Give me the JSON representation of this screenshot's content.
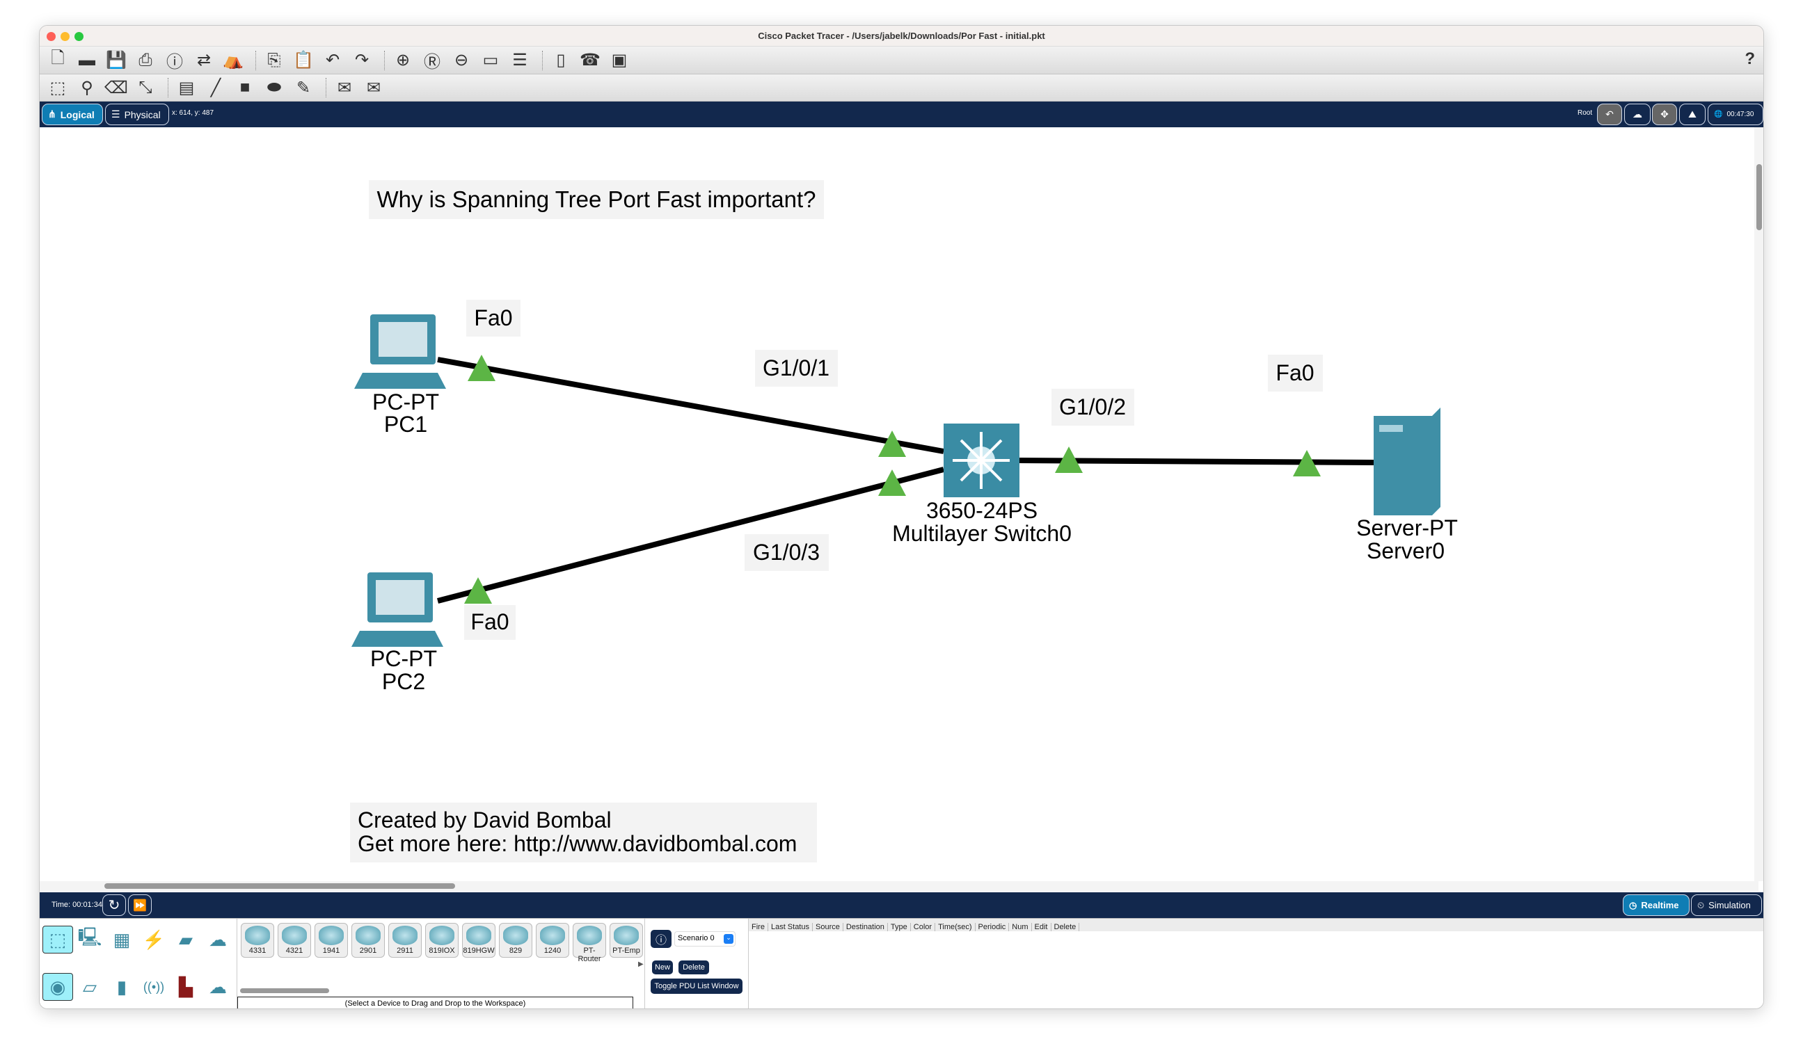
{
  "window": {
    "title": "Cisco Packet Tracer - /Users/jabelk/Downloads/Por Fast - initial.pkt"
  },
  "toolbar1": {
    "icons": [
      "new-file-icon",
      "open-folder-icon",
      "save-icon",
      "print-icon",
      "info-icon",
      "activity-wizard-icon",
      "custom-device-icon",
      "|",
      "copy-icon",
      "paste-icon",
      "undo-icon",
      "redo-icon",
      "|",
      "zoom-in-icon",
      "zoom-reset-icon",
      "zoom-out-icon",
      "window-icon",
      "list-icon",
      "|",
      "device-template-icon",
      "ip-phone-icon",
      "image-icon"
    ],
    "help": "?"
  },
  "toolbar2": {
    "icons": [
      "select-icon",
      "inspect-icon",
      "delete-icon",
      "resize-icon",
      "|",
      "note-icon",
      "line-icon",
      "rectangle-icon",
      "ellipse-icon",
      "freeform-icon",
      "|",
      "simple-pdu-icon",
      "complex-pdu-icon"
    ]
  },
  "nav": {
    "logical": "Logical",
    "physical": "Physical",
    "coords": "x: 614, y: 487",
    "root": "Root",
    "clock": "00:47:30"
  },
  "canvas": {
    "heading": "Why is Spanning Tree Port Fast important?",
    "credits": [
      "Created by David Bombal",
      "Get more here: http://www.davidbombal.com"
    ],
    "devices": [
      {
        "model": "PC-PT",
        "name": "PC1"
      },
      {
        "model": "PC-PT",
        "name": "PC2"
      },
      {
        "model": "3650-24PS",
        "name": "Multilayer Switch0"
      },
      {
        "model": "Server-PT",
        "name": "Server0"
      }
    ],
    "ports": {
      "pc1": "Fa0",
      "sw_pc1": "G1/0/1",
      "pc2": "Fa0",
      "sw_pc2": "G1/0/3",
      "sw_srv": "G1/0/2",
      "srv": "Fa0"
    },
    "link_color": "#000000",
    "link_status_color": "#5cb545"
  },
  "bottom": {
    "time": "Time: 00:01:34",
    "realtime": "Realtime",
    "simulation": "Simulation"
  },
  "panel": {
    "devices": [
      "4331",
      "4321",
      "1941",
      "2901",
      "2911",
      "819IOX",
      "819HGW",
      "829",
      "1240",
      "PT-Router",
      "PT-Emp"
    ],
    "hint": "(Select a Device to Drag and Drop to the Workspace)",
    "scenario": "Scenario 0",
    "new": "New",
    "delete": "Delete",
    "toggle": "Toggle PDU List Window",
    "columns": [
      "Fire",
      "Last Status",
      "Source",
      "Destination",
      "Type",
      "Color",
      "Time(sec)",
      "Periodic",
      "Num",
      "Edit",
      "Delete"
    ]
  }
}
